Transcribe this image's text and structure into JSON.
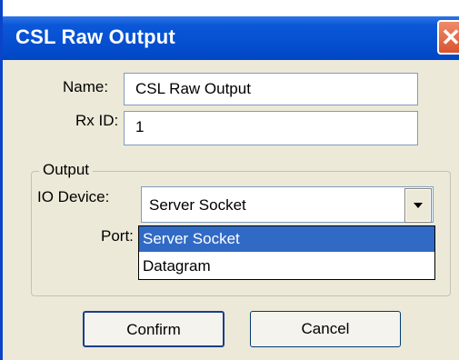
{
  "window": {
    "title": "CSL Raw Output"
  },
  "form": {
    "name_label": "Name:",
    "name_value": "CSL Raw Output",
    "rxid_label": "Rx ID:",
    "rxid_value": "1"
  },
  "output": {
    "group_label": "Output",
    "io_device_label": "IO Device:",
    "io_device_value": "Server Socket",
    "port_label": "Port:",
    "options": [
      "Server Socket",
      "Datagram"
    ],
    "selected_index": 0
  },
  "buttons": {
    "confirm": "Confirm",
    "cancel": "Cancel"
  },
  "icons": {
    "close": "close-icon",
    "dropdown": "chevron-down-icon"
  },
  "colors": {
    "titlebar": "#0550d0",
    "selection": "#316ac5",
    "close": "#d9532f"
  }
}
